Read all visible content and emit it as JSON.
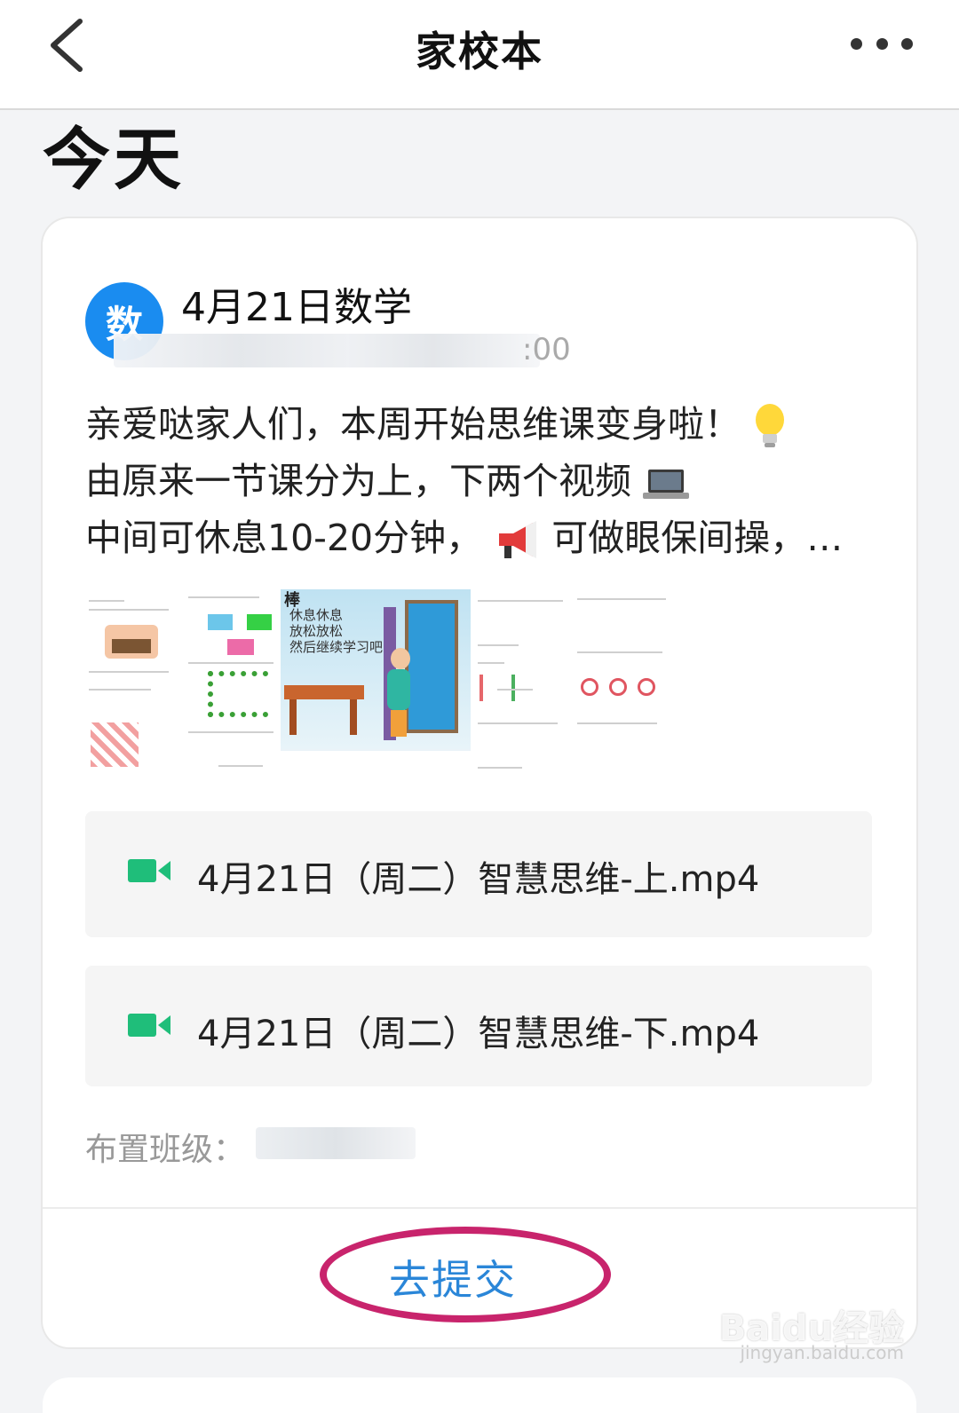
{
  "nav": {
    "title": "家校本",
    "back_icon": "chevron-left-icon",
    "more_icon": "more-horizontal-icon"
  },
  "section_title": "今天",
  "card": {
    "avatar_text": "数",
    "title": "4月21日数学",
    "meta_visible_tail": ":00",
    "body_lines": [
      "亲爱哒家人们，本周开始思维课变身啦！",
      "由原来一节课分为上，下两个视频",
      "中间可休息10-20分钟，",
      "可做眼保间操，…"
    ],
    "files": [
      {
        "name": "4月21日（周二）智慧思维-上.mp4"
      },
      {
        "name": "4月21日（周二）智慧思维-下.mp4"
      }
    ],
    "class_label": "布置班级：",
    "submit_label": "去提交"
  },
  "thumbnail_text": {
    "poster_lines": [
      "休息休息",
      "放松放松",
      "然后继续学习吧"
    ],
    "badge": "棒"
  },
  "watermark": {
    "brand": "Baidu经验",
    "url": "jingyan.baidu.com"
  },
  "colors": {
    "accent": "#1a8cf0",
    "submit": "#2a86d8",
    "ring": "#c8246c",
    "video_icon": "#1fbe7a"
  }
}
